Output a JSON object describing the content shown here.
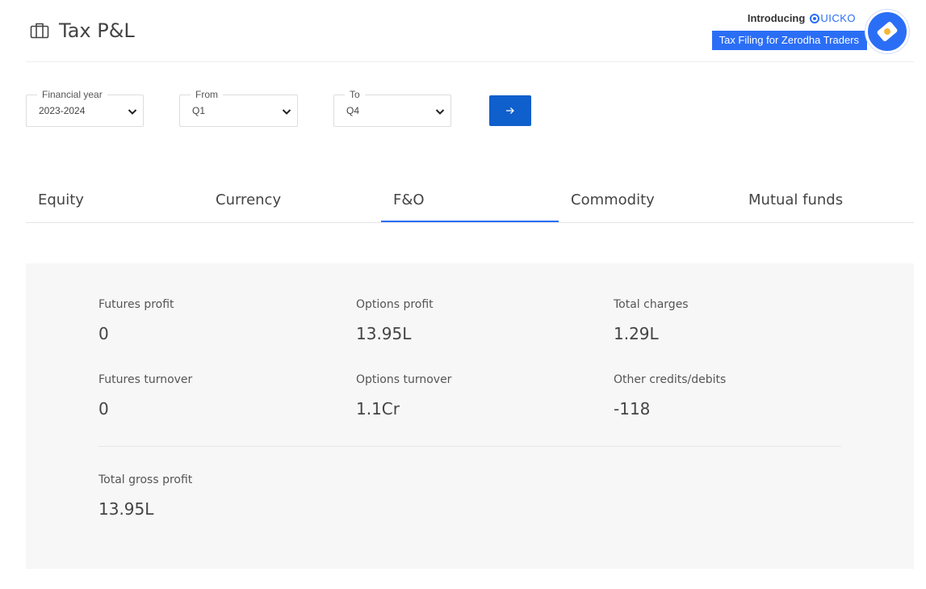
{
  "header": {
    "title": "Tax P&L",
    "title_icon": "briefcase-icon"
  },
  "promo": {
    "intro": "Introducing",
    "brand": "UICKO",
    "tagline": "Tax Filing for Zerodha Traders",
    "badge_icon": "quicko-badge-icon"
  },
  "filters": {
    "financial_year": {
      "label": "Financial year",
      "value": "2023-2024"
    },
    "from": {
      "label": "From",
      "value": "Q1"
    },
    "to": {
      "label": "To",
      "value": "Q4"
    },
    "submit_icon": "arrow-right-icon"
  },
  "tabs": [
    {
      "label": "Equity",
      "active": false
    },
    {
      "label": "Currency",
      "active": false
    },
    {
      "label": "F&O",
      "active": true
    },
    {
      "label": "Commodity",
      "active": false
    },
    {
      "label": "Mutual funds",
      "active": false
    }
  ],
  "summary": {
    "futures_profit": {
      "label": "Futures profit",
      "value": "0"
    },
    "options_profit": {
      "label": "Options profit",
      "value": "13.95L"
    },
    "total_charges": {
      "label": "Total charges",
      "value": "1.29L"
    },
    "futures_turnover": {
      "label": "Futures turnover",
      "value": "0"
    },
    "options_turnover": {
      "label": "Options turnover",
      "value": "1.1Cr"
    },
    "other_credits_debits": {
      "label": "Other credits/debits",
      "value": "-118"
    },
    "total_gross_profit": {
      "label": "Total gross profit",
      "value": "13.95L"
    }
  },
  "colors": {
    "accent": "#2b6ef6",
    "button": "#0f5fcc",
    "panel_bg": "#f7f7f7",
    "text": "#444444"
  }
}
